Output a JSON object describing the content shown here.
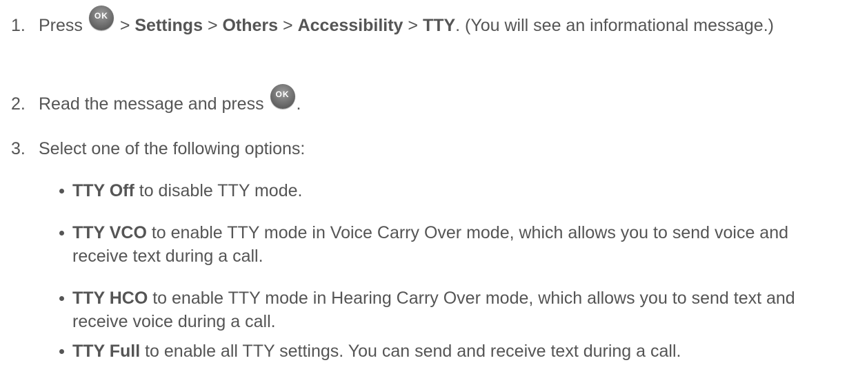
{
  "steps": [
    {
      "number": "1.",
      "press": "Press",
      "sep": ">",
      "settings": "Settings",
      "others": "Others",
      "accessibility": "Accessibility",
      "tty": "TTY",
      "end": ". (You will see an informational message.)"
    },
    {
      "number": "2.",
      "text": "Read the message and press",
      "end": "."
    },
    {
      "number": "3.",
      "text": "Select one of the following options:"
    }
  ],
  "ok_button": {
    "label": "OK",
    "icon": "ok-button-icon"
  },
  "options": [
    {
      "bold": "TTY Off",
      "text": " to disable TTY mode."
    },
    {
      "bold": "TTY VCO",
      "text": " to enable TTY mode in Voice Carry Over mode, which allows you to send voice and receive text during a call."
    },
    {
      "bold": "TTY HCO",
      "text": " to enable TTY mode in Hearing Carry Over mode, which allows you to send text and receive voice during a call."
    },
    {
      "bold": "TTY Full",
      "text": " to enable all TTY settings. You can send and receive text during a call."
    }
  ]
}
